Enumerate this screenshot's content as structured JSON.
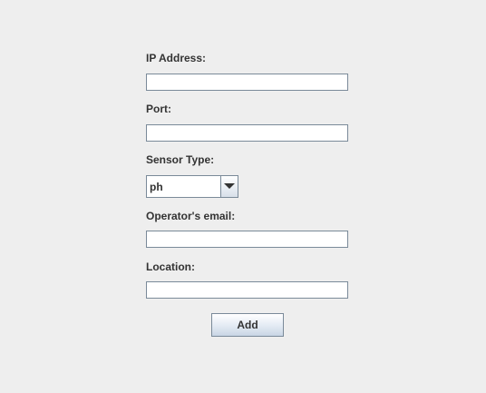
{
  "form": {
    "ip_label": "IP Address:",
    "ip_value": "",
    "port_label": "Port:",
    "port_value": "",
    "sensor_label": "Sensor Type:",
    "sensor_selected": "ph",
    "email_label": "Operator's email:",
    "email_value": "",
    "location_label": "Location:",
    "location_value": "",
    "add_label": "Add"
  },
  "icons": {
    "combo_arrow": "chevron-down-icon"
  }
}
